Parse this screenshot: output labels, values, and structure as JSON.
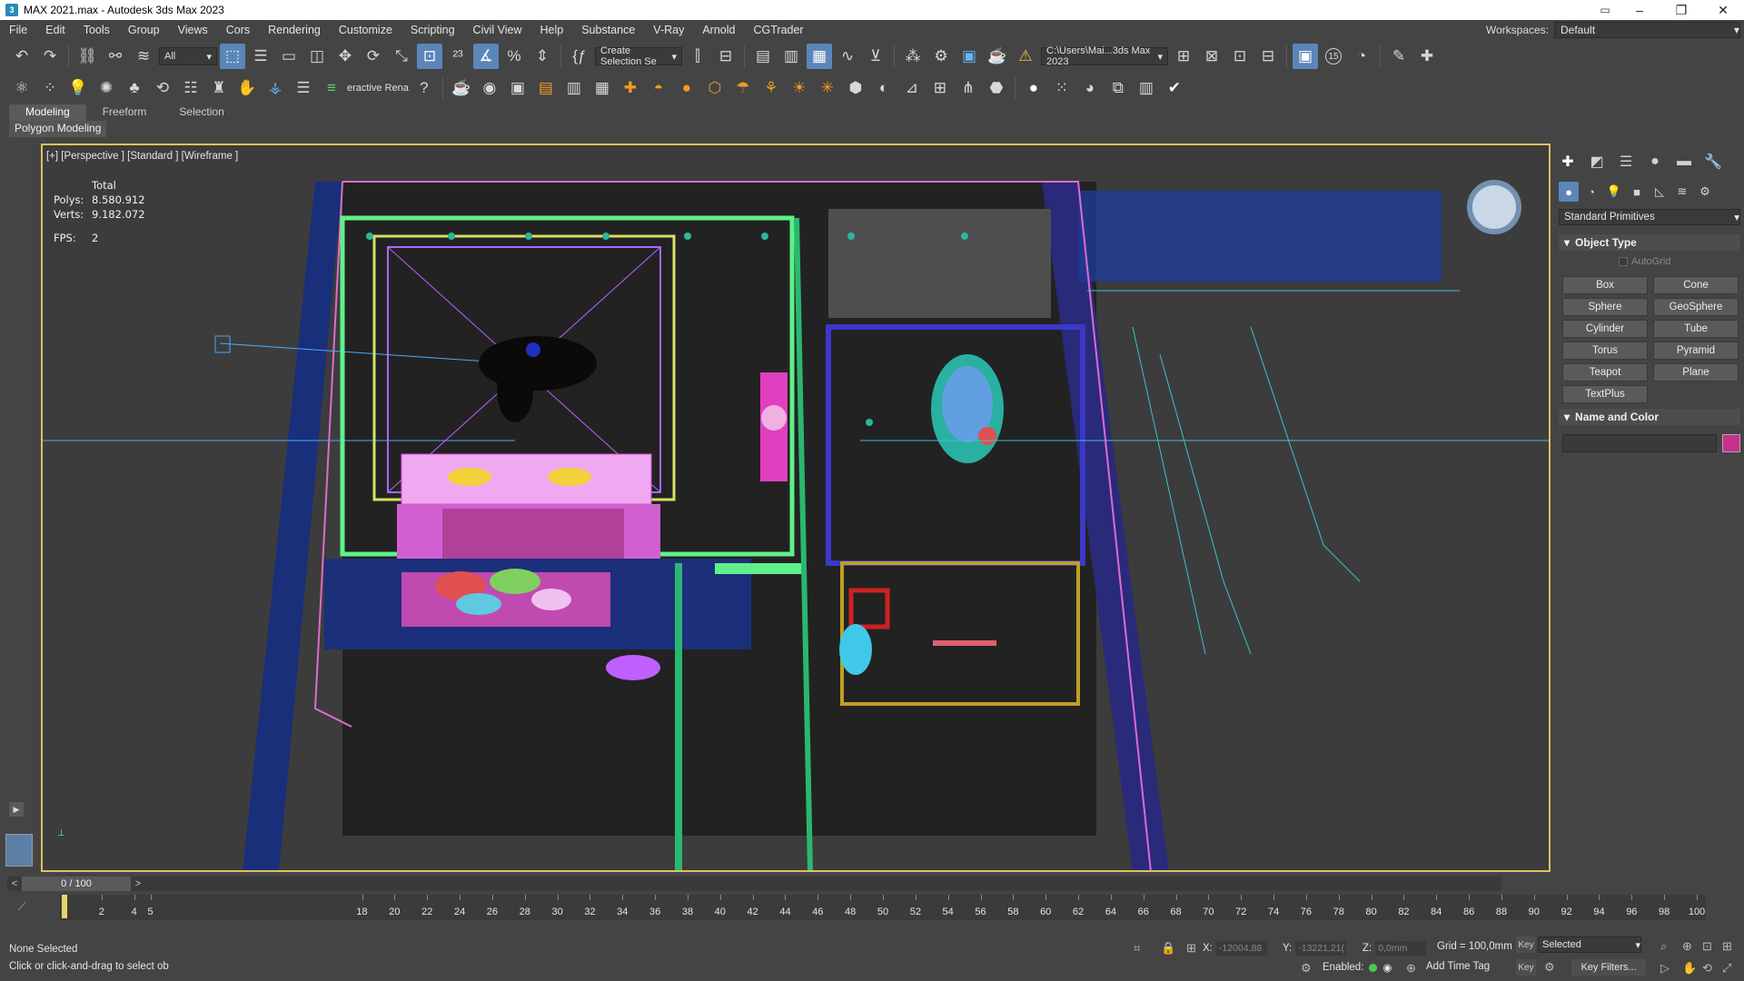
{
  "window": {
    "title": "MAX 2021.max - Autodesk 3ds Max 2023",
    "app_icon_letter": "3",
    "controls": {
      "minimize": "–",
      "maximize": "❐",
      "close": "✕"
    }
  },
  "menu": {
    "items": [
      "File",
      "Edit",
      "Tools",
      "Group",
      "Views",
      "Cors",
      "Rendering",
      "Customize",
      "Scripting",
      "Civil View",
      "Help",
      "Substance",
      "V-Ray",
      "Arnold",
      "CGTrader"
    ],
    "workspaces_label": "Workspaces:",
    "workspaces_value": "Default"
  },
  "toolbar_main": {
    "filter_value": "All",
    "selection_set_placeholder": "Create Selection Se",
    "path_value": "C:\\Users\\Mai...3ds Max 2023",
    "badge_15": "15"
  },
  "toolbar_secondary": {
    "interactive_label": "eractive Rena"
  },
  "ribbon": {
    "tabs": [
      "Modeling",
      "Freeform",
      "Selection"
    ],
    "active_tab": "Modeling",
    "panel_label": "Polygon Modeling"
  },
  "viewport": {
    "label": "[+] [Perspective ] [Standard ] [Wireframe ]",
    "stats": {
      "header": "Total",
      "polys_label": "Polys:",
      "polys_value": "8.580.912",
      "verts_label": "Verts:",
      "verts_value": "9.182.072",
      "fps_label": "FPS:",
      "fps_value": "2"
    }
  },
  "command_panel": {
    "dropdown_value": "Standard Primitives",
    "object_type_title": "Object Type",
    "autogrid_label": "AutoGrid",
    "primitives": [
      "Box",
      "Cone",
      "Sphere",
      "GeoSphere",
      "Cylinder",
      "Tube",
      "Torus",
      "Pyramid",
      "Teapot",
      "Plane",
      "TextPlus"
    ],
    "name_color_title": "Name and Color",
    "object_color": "#c8308c"
  },
  "timeline": {
    "slider_label": "0 / 100",
    "ticks": [
      "2",
      "4",
      "5",
      "18",
      "20",
      "22",
      "24",
      "26",
      "28",
      "30",
      "32",
      "34",
      "36",
      "38",
      "40",
      "42",
      "44",
      "46",
      "48",
      "50",
      "52",
      "54",
      "56",
      "58",
      "60",
      "62",
      "64",
      "66",
      "68",
      "70",
      "72",
      "74",
      "76",
      "78",
      "80",
      "82",
      "84",
      "86",
      "88",
      "90",
      "92",
      "94",
      "96",
      "98",
      "100"
    ]
  },
  "status": {
    "selection": "None Selected",
    "hint": "Click or click-and-drag to select ob",
    "x_label": "X:",
    "x_value": "-12004,88",
    "y_label": "Y:",
    "y_value": "-13221,21(",
    "z_label": "Z:",
    "z_value": "0,0mm",
    "grid": "Grid = 100,0mm",
    "key_label": "Key",
    "selected_value": "Selected",
    "enabled_label": "Enabled:",
    "add_time_tag": "Add Time Tag",
    "key_filters": "Key Filters..."
  }
}
